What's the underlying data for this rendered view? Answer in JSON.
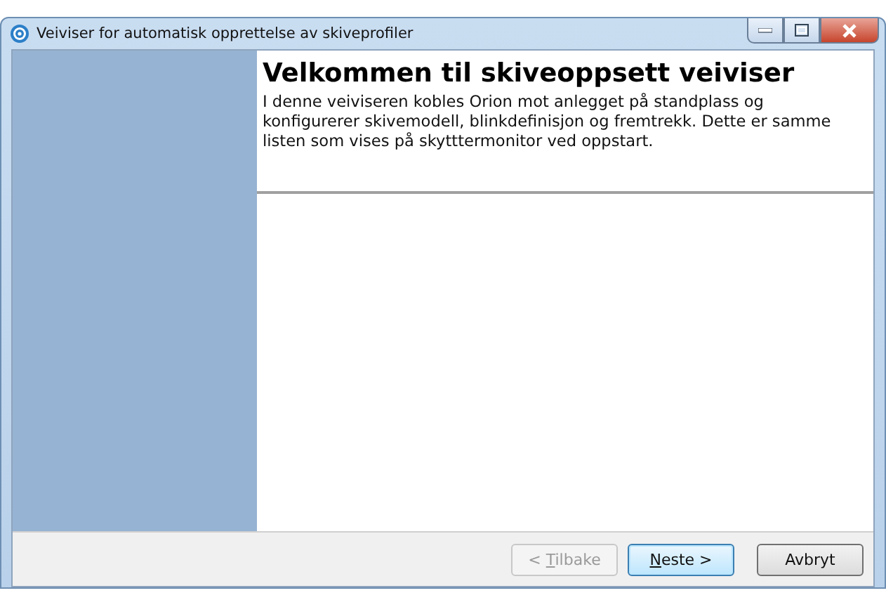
{
  "window": {
    "title": "Veiviser for automatisk opprettelse av skiveprofiler"
  },
  "header": {
    "title": "Velkommen til skiveoppsett veiviser",
    "description": "I denne veiviseren kobles Orion mot anlegget på standplass og konfigurerer skivemodell, blinkdefinisjon og fremtrekk. Dette er samme listen som vises på skytttermonitor ved oppstart."
  },
  "buttons": [
    {
      "pre": "< ",
      "key": "T",
      "post": "ilbake",
      "disabled": true,
      "default": false
    },
    {
      "key": "N",
      "post": "este >",
      "disabled": false,
      "default": true
    },
    {
      "post": "Avbryt",
      "disabled": false,
      "default": false
    }
  ]
}
